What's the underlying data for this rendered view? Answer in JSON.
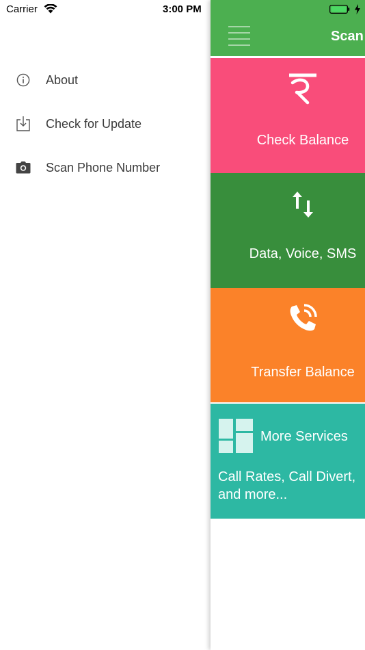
{
  "status_bar": {
    "carrier": "Carrier",
    "time": "3:00 PM"
  },
  "drawer": {
    "items": [
      {
        "label": "About",
        "icon": "info-icon"
      },
      {
        "label": "Check for Update",
        "icon": "download-icon"
      },
      {
        "label": "Scan Phone Number",
        "icon": "camera-icon"
      }
    ]
  },
  "main": {
    "title": "Scan",
    "tiles": [
      {
        "label": "Check Balance",
        "icon": "rupee-icon",
        "color": "#f94d7a"
      },
      {
        "label": "Data, Voice, SMS",
        "icon": "up-down-arrows-icon",
        "color": "#388e3c"
      },
      {
        "label": "Transfer Balance",
        "icon": "phone-call-icon",
        "color": "#fb8229"
      },
      {
        "label": "More Services",
        "icon": "dashboard-icon",
        "color": "#2db8a3",
        "subtitle_line1": "Call Rates, Call Divert,",
        "subtitle_line2": "and more..."
      }
    ]
  },
  "colors": {
    "navbar": "#4caf50",
    "drawer_text": "#3a3a3a",
    "drawer_icon": "#555555"
  }
}
